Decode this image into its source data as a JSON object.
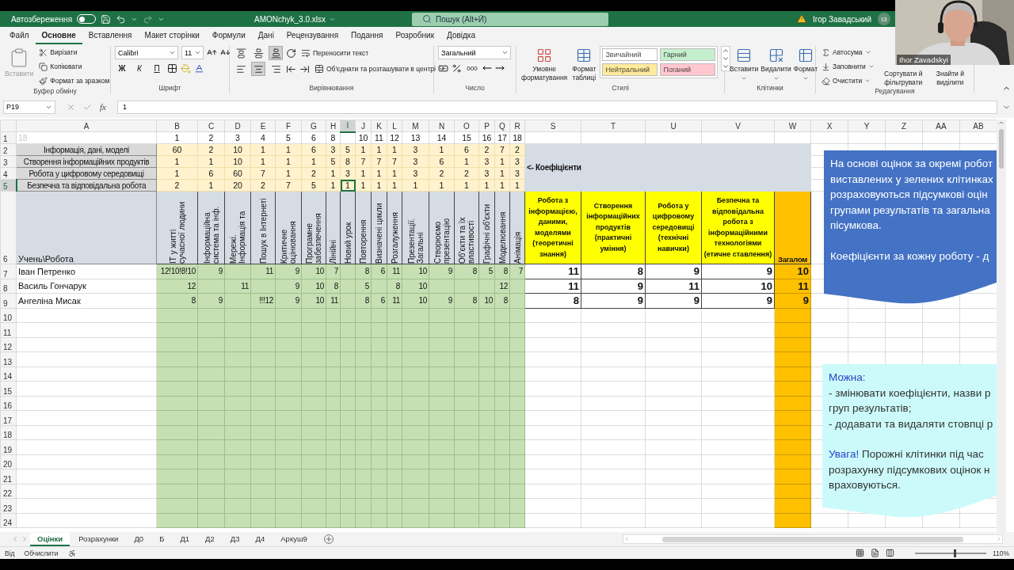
{
  "title_bar": {
    "autosave_label": "Автозбереження",
    "autosave_on": false,
    "file_name": "AMONchyk_3.0.xlsx",
    "search_placeholder": "Пошук (Alt+Й)",
    "user_name": "Ігор Завадський",
    "user_initials": "ІЗ"
  },
  "video": {
    "kind": "picture",
    "caption": "Ihor Zavadskyi"
  },
  "ribbon_tabs": [
    {
      "label": "Файл",
      "selected": false
    },
    {
      "label": "Основне",
      "selected": true
    },
    {
      "label": "Вставлення",
      "selected": false
    },
    {
      "label": "Макет сторінки",
      "selected": false
    },
    {
      "label": "Формули",
      "selected": false
    },
    {
      "label": "Дані",
      "selected": false
    },
    {
      "label": "Рецензування",
      "selected": false
    },
    {
      "label": "Подання",
      "selected": false
    },
    {
      "label": "Розробник",
      "selected": false
    },
    {
      "label": "Довідка",
      "selected": false
    }
  ],
  "ribbon": {
    "clipboard": {
      "label": "Буфер обміну",
      "paste": {
        "label": "Вставити",
        "disabled": true
      },
      "commands": [
        "Вирізати",
        "Копіювати",
        "Формат за зразком"
      ]
    },
    "font": {
      "label": "Шрифт",
      "font_name": "Calibri",
      "font_size": "11",
      "bold": "Ж",
      "italic": "К",
      "underline": "П"
    },
    "alignment": {
      "label": "Вирівнювання",
      "vertical": [
        {
          "selected": false
        },
        {
          "selected": false
        },
        {
          "selected": true
        }
      ],
      "horizontal": [
        {
          "selected": false
        },
        {
          "selected": true
        },
        {
          "selected": false
        }
      ],
      "wrap": "Переносити текст",
      "merge": "Об'єднати та розташувати в центрі"
    },
    "number": {
      "label": "Число",
      "format": "Загальний",
      "thousands": "000"
    },
    "styles": {
      "label": "Стилі",
      "conditional": "Умовне форматування",
      "table": "Формат таблиці",
      "cell_styles": [
        {
          "label": "Звичайний",
          "color": "#ffffff"
        },
        {
          "label": "Гарний",
          "color": "#c6efce"
        },
        {
          "label": "Нейтральний",
          "color": "#ffeb9c"
        },
        {
          "label": "Поганий",
          "color": "#ffc7ce"
        }
      ]
    },
    "cells": {
      "label": "Клітинки",
      "commands": [
        "Вставити",
        "Видалити",
        "Формат"
      ]
    },
    "editing": {
      "label": "Редагування",
      "commands": [
        "Автосума",
        "Заповнити",
        "Очистити"
      ],
      "sort": "Сортувати й фільтрувати",
      "find": "Знайти й виділити"
    }
  },
  "formula_bar": {
    "name_box": "P19",
    "function_label": "fx",
    "value": "1"
  },
  "sheet": {
    "columns": [
      {
        "label": "A",
        "selected": false
      },
      {
        "label": "B",
        "selected": false
      },
      {
        "label": "C",
        "selected": false
      },
      {
        "label": "D",
        "selected": false
      },
      {
        "label": "E",
        "selected": false
      },
      {
        "label": "F",
        "selected": false
      },
      {
        "label": "G",
        "selected": false
      },
      {
        "label": "H",
        "selected": false
      },
      {
        "label": "I",
        "selected": true
      },
      {
        "label": "J",
        "selected": false
      },
      {
        "label": "K",
        "selected": false
      },
      {
        "label": "L",
        "selected": false
      },
      {
        "label": "M",
        "selected": false
      },
      {
        "label": "N",
        "selected": false
      },
      {
        "label": "O",
        "selected": false
      },
      {
        "label": "P",
        "selected": false
      },
      {
        "label": "Q",
        "selected": false
      },
      {
        "label": "R",
        "selected": false
      },
      {
        "label": "S",
        "selected": false
      },
      {
        "label": "T",
        "selected": false
      },
      {
        "label": "U",
        "selected": false
      },
      {
        "label": "V",
        "selected": false
      },
      {
        "label": "W",
        "selected": false
      },
      {
        "label": "X",
        "selected": false
      },
      {
        "label": "Y",
        "selected": false
      },
      {
        "label": "Z",
        "selected": false
      },
      {
        "label": "AA",
        "selected": false
      },
      {
        "label": "AB",
        "selected": false
      }
    ],
    "row_numbers": [
      {
        "label": "1",
        "selected": false
      },
      {
        "label": "2",
        "selected": false
      },
      {
        "label": "3",
        "selected": false
      },
      {
        "label": "4",
        "selected": false
      },
      {
        "label": "5",
        "selected": true
      },
      {
        "label": "6",
        "selected": false
      },
      {
        "label": "7",
        "selected": false
      },
      {
        "label": "8",
        "selected": false
      },
      {
        "label": "9",
        "selected": false
      },
      {
        "label": "10",
        "selected": false
      },
      {
        "label": "11",
        "selected": false
      },
      {
        "label": "12",
        "selected": false
      },
      {
        "label": "13",
        "selected": false
      },
      {
        "label": "14",
        "selected": false
      },
      {
        "label": "15",
        "selected": false
      },
      {
        "label": "16",
        "selected": false
      },
      {
        "label": "17",
        "selected": false
      },
      {
        "label": "18",
        "selected": false
      },
      {
        "label": "19",
        "selected": false
      },
      {
        "label": "20",
        "selected": false
      },
      {
        "label": "21",
        "selected": false
      },
      {
        "label": "22",
        "selected": false
      },
      {
        "label": "23",
        "selected": false
      },
      {
        "label": "24",
        "selected": false
      }
    ],
    "row1": {
      "A": "18",
      "B": "1",
      "C": "2",
      "D": "3",
      "E": "4",
      "F": "5",
      "G": "6",
      "H": "8",
      "J": "10",
      "K": "11",
      "L": "12",
      "M": "13",
      "N": "14",
      "O": "15",
      "P": "16",
      "Q": "17",
      "R": "18"
    },
    "coefficient_rows": [
      {
        "label": "Інформація, дані, моделі",
        "values": [
          "60",
          "2",
          "10",
          "1",
          "1",
          "6",
          "3",
          "5",
          "1",
          "1",
          "1",
          "3",
          "1",
          "6",
          "2",
          "7",
          "2"
        ]
      },
      {
        "label": "Створення інформаційних продуктів",
        "values": [
          "1",
          "1",
          "10",
          "1",
          "1",
          "1",
          "5",
          "8",
          "7",
          "7",
          "7",
          "3",
          "6",
          "1",
          "3",
          "1",
          "3"
        ]
      },
      {
        "label": "Робота у цифровому середовищі",
        "values": [
          "1",
          "6",
          "60",
          "7",
          "1",
          "2",
          "1",
          "3",
          "1",
          "1",
          "1",
          "3",
          "2",
          "2",
          "3",
          "1",
          "3"
        ]
      },
      {
        "label": "Безпечна та відповідальна робота",
        "values": [
          "2",
          "1",
          "20",
          "2",
          "7",
          "5",
          "1",
          "1",
          "1",
          "1",
          "1",
          "1",
          "1",
          "1",
          "1",
          "1",
          "1"
        ]
      }
    ],
    "coefficients_label": "<- Коефіцієнти",
    "header": {
      "corner": "Учень\\Робота",
      "works": [
        "ІТ у житті сучасної людини",
        "Інформаційна система та інф.",
        "Мережі. Інформація та",
        "Пошук в Інтернеті",
        "Критичне оцінювання",
        "Програмне забезпечення",
        "Лінійні",
        "Новий урок",
        "Повторення",
        "Визначені цикли",
        "Розгалуження",
        "Презентації. Загальні",
        "Створюємо презентацію",
        "Об'єкти та їх властивості",
        "Графічні об'єкти",
        "Моделювання",
        "Анімація"
      ],
      "groups": [
        "Робота з інформацією, даними, моделями (теоретичні знання)",
        "Створення інформаційних продуктів (практичні уміння)",
        "Робота у цифровому середовищі (технічні навички)",
        "Безпечна та відповідальна робота з інформаційними технологіями (етичне ставлення)"
      ],
      "total": "Загалом"
    },
    "students": [
      {
        "name": "Іван Петренко",
        "grades": {
          "B": "12!10!8!10",
          "C": "9",
          "E": "11",
          "F": "9",
          "G": "10",
          "H": "7",
          "J": "8",
          "K": "6",
          "L": "11",
          "M": "10",
          "N": "9",
          "O": "8",
          "P": "5",
          "Q": "8",
          "R": "7"
        },
        "group_scores": [
          "11",
          "8",
          "9",
          "9"
        ],
        "total": "10"
      },
      {
        "name": "Василь Гончарук",
        "grades": {
          "B": "12",
          "D": "11",
          "F": "9",
          "G": "10",
          "H": "8",
          "J": "5",
          "L": "8",
          "M": "10",
          "Q": "12"
        },
        "group_scores": [
          "11",
          "9",
          "11",
          "10"
        ],
        "total": "11"
      },
      {
        "name": "Ангеліна Мисак",
        "grades": {
          "B": "8",
          "C": "9",
          "E": "!!!12",
          "F": "9",
          "G": "10",
          "H": "11",
          "J": "8",
          "K": "6",
          "L": "11",
          "M": "10",
          "N": "9",
          "O": "8",
          "P": "10",
          "Q": "8"
        },
        "group_scores": [
          "8",
          "9",
          "9",
          "9"
        ],
        "total": "9"
      }
    ]
  },
  "notes": [
    {
      "kind": "dark",
      "paragraphs": [
        [
          {
            "text": "На основі оцінок за окремі робот"
          },
          {
            "text": "виставлених у зелених клітинках"
          },
          {
            "text": "розраховуються підсумкові оцін"
          },
          {
            "text": "групами результатів та загальна"
          },
          {
            "text": "пісумкова."
          }
        ],
        [
          {
            "text": "Коефіцієнти за кожну роботу - д"
          }
        ]
      ]
    },
    {
      "kind": "light",
      "paragraphs": [
        [
          {
            "emphasis": "Можна:"
          },
          {
            "text": "- змінювати коефіцієнти, назви р"
          },
          {
            "text": "груп результатів;"
          },
          {
            "text": "- додавати та видаляти стовпці р"
          }
        ],
        [
          {
            "emphasis": "Увага!",
            "text": "Порожні клітинки під час"
          },
          {
            "text": "розрахунку підсумкових оцінок н"
          },
          {
            "text": "враховуються."
          }
        ]
      ]
    }
  ],
  "sheet_tabs": [
    {
      "label": "Оцінки",
      "selected": true
    },
    {
      "label": "Розрахунки",
      "selected": false
    },
    {
      "label": "Д0",
      "selected": false
    },
    {
      "label": "Б",
      "selected": false
    },
    {
      "label": "Д1",
      "selected": false
    },
    {
      "label": "Д2",
      "selected": false
    },
    {
      "label": "Д3",
      "selected": false
    },
    {
      "label": "Д4",
      "selected": false
    },
    {
      "label": "Аркуш9",
      "selected": false
    }
  ],
  "status_bar": {
    "items": [
      "Від",
      "Обчислити"
    ],
    "zoom": {
      "level": 0.55,
      "reading": "110%"
    }
  }
}
